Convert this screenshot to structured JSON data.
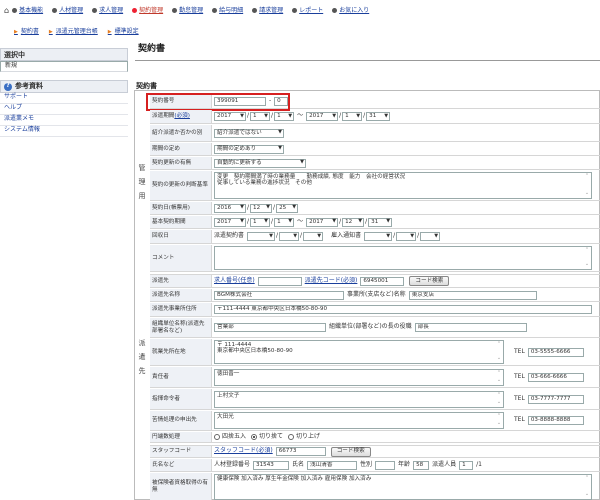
{
  "topnav": {
    "items": [
      {
        "label": "基本機能",
        "active": false
      },
      {
        "label": "人材管理",
        "active": false
      },
      {
        "label": "求人管理",
        "active": false
      },
      {
        "label": "契約管理",
        "active": true
      },
      {
        "label": "勤怠管理",
        "active": false
      },
      {
        "label": "給与明細",
        "active": false
      },
      {
        "label": "請求管理",
        "active": false
      },
      {
        "label": "レポート",
        "active": false
      },
      {
        "label": "お気に入り",
        "active": false
      }
    ]
  },
  "subnav": {
    "items": [
      "契約書",
      "派遣元管理台帳",
      "標準設定"
    ]
  },
  "sidebar": {
    "selected_head": "選択中",
    "selected_item": "新規",
    "ref_head": "参考資料",
    "links": [
      "サポート",
      "ヘルプ",
      "派遣業メモ",
      "システム情報"
    ]
  },
  "page": {
    "title": "契約書",
    "section_title": "契約書"
  },
  "groups": {
    "kanri": [
      "管",
      "理",
      "用"
    ],
    "haken": [
      "派",
      "遣",
      "先"
    ]
  },
  "form": {
    "contract_no": {
      "label": "契約番号",
      "value": "399091",
      "sep": "-",
      "sub": "0"
    },
    "period": {
      "label": "派遣期間",
      "req": "(必須)",
      "y1": "2017",
      "m1": "1",
      "d1": "1",
      "tilde": "〜",
      "y2": "2017",
      "m2": "1",
      "d2": "31"
    },
    "shokai": {
      "label": "紹介派遣か否かの別",
      "value": "紹介派遣ではない"
    },
    "kikan_sadame": {
      "label": "期間の定め",
      "value": "期間の定めあり"
    },
    "koshin_umu": {
      "label": "契約更新の有無",
      "value": "自動的に更新する"
    },
    "koshin_kijun": {
      "label": "契約の更新の判断基準",
      "value": "変更　契約期間満了時の業務量　　勤務成績, 態度　能力　会社の経営状況\n従事している業務の進捗状況　その他"
    },
    "keiyaku_date": {
      "label": "契約日(帳票用)",
      "y": "2016",
      "m": "12",
      "d": "25"
    },
    "kihon_kikan": {
      "label": "基本契約期間",
      "y1": "2017",
      "m1": "1",
      "d1": "1",
      "tilde": "〜",
      "y2": "2017",
      "m2": "12",
      "d2": "31"
    },
    "kaishu": {
      "label": "回収日",
      "haken_label": "派遣契約書",
      "tsuchi_label": "雇入通知書"
    },
    "comment": {
      "label": "コメント"
    },
    "hakensaki": {
      "label": "派遣先",
      "kyujin_label": "求人番号(任意)",
      "code_label": "派遣先コード(必須)",
      "code_value": "6945001",
      "search_btn": "コード検索"
    },
    "hakensaki_name": {
      "label": "派遣先名称",
      "value": "BGM株式会社",
      "office_label": "事業所(支店など)名称",
      "office_value": "東京支店"
    },
    "hakensaki_addr": {
      "label": "派遣先事業所住所",
      "value": "〒111-4444 東京都中央区日本橋50-80-90"
    },
    "soshiki": {
      "label": "組織単位名称(派遣先部署名など)",
      "value": "営業部",
      "pos_label": "組織単位(部署など)の長の役職",
      "pos_value": "部長"
    },
    "shugyo": {
      "label": "就業先所在地",
      "zip": "〒 111-4444",
      "addr": "東京都中央区日本橋50-80-90",
      "tel_label": "TEL",
      "tel": "03-5555-6666"
    },
    "sekinin": {
      "label": "責任者",
      "value": "徳田晋一",
      "tel_label": "TEL",
      "tel": "03-666-6666"
    },
    "shiki": {
      "label": "指揮命令者",
      "value": "上村文子",
      "tel_label": "TEL",
      "tel": "03-7777-7777"
    },
    "kujo": {
      "label": "苦情処理の申出先",
      "value": "大田光",
      "tel_label": "TEL",
      "tel": "03-8888-8888"
    },
    "hasu": {
      "label": "円端数処理",
      "opt1": "四捨五入",
      "opt2": "切り捨て",
      "opt3": "切り上げ"
    },
    "staff_code": {
      "label": "スタッフコード",
      "code_label": "スタッフコード(必須)",
      "value": "66773",
      "search_btn": "コード検索"
    },
    "shimei": {
      "label": "氏名など",
      "jinzai_label": "人材登録番号",
      "jinzai_value": "31543",
      "name_label": "氏名",
      "name_value": "浅山清香",
      "sex_label": "性別",
      "age_label": "年齢",
      "age_value": "58",
      "count_label": "派遣人員",
      "count_value": "1",
      "count_sep": "/1"
    },
    "hoken": {
      "label": "被保険者資格取得の有無",
      "value": "健康保険 加入済み 厚生年金保険 加入済み 雇用保険 加入済み"
    }
  }
}
